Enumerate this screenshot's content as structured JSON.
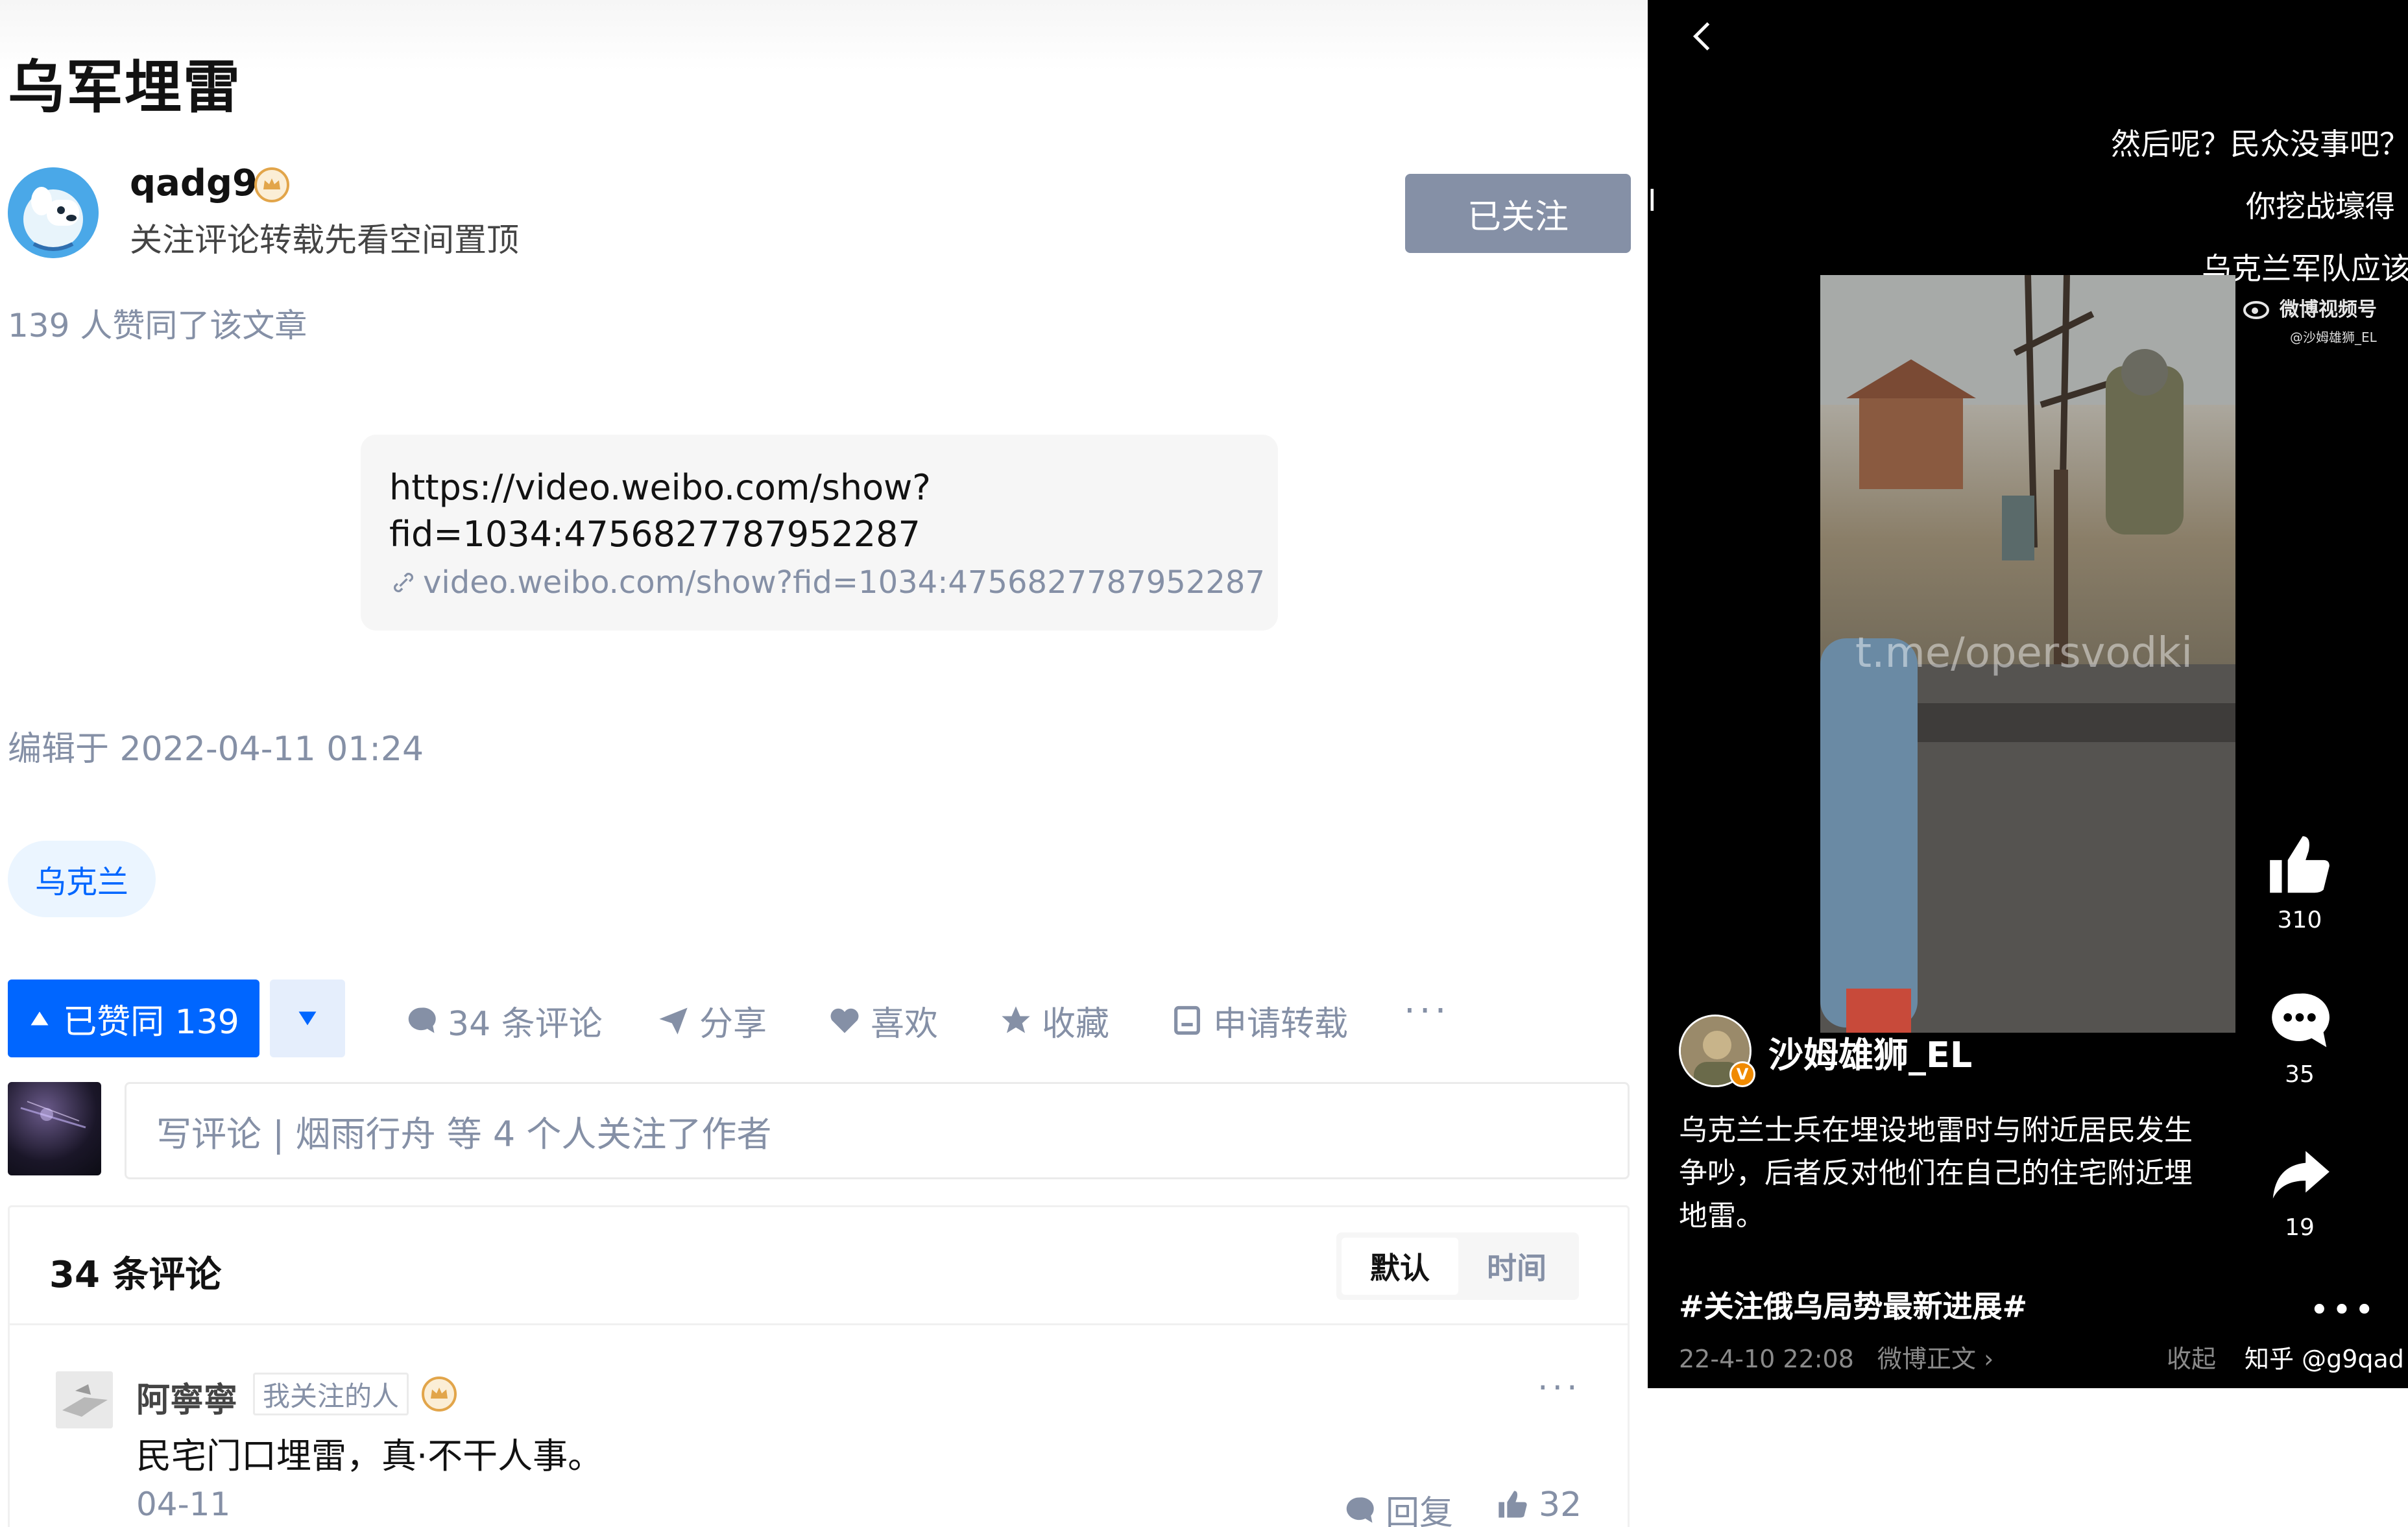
{
  "article": {
    "title": "乌军埋雷",
    "author": {
      "name": "qadg9",
      "bio": "关注评论转载先看空间置顶",
      "follow_label": "已关注"
    },
    "like_summary": "139 人赞同了该文章",
    "link_card": {
      "line1": "https://video.weibo.com/show?",
      "line2": "fid=1034:4756827787952287",
      "short_url": "video.weibo.com/show?fid=1034:4756827787952287"
    },
    "edited": "编辑于 2022-04-11 01:24",
    "topic": "乌克兰"
  },
  "actions": {
    "vote_up": "已赞同 139",
    "vote_down_icon": "triangle-down-icon",
    "comments": "34 条评论",
    "share": "分享",
    "like": "喜欢",
    "collect": "收藏",
    "repost": "申请转载",
    "more": "···"
  },
  "comment_input": {
    "placeholder": "写评论 | 烟雨行舟 等 4 个人关注了作者"
  },
  "comments": {
    "title": "34 条评论",
    "sort": [
      "默认",
      "时间"
    ],
    "items": [
      {
        "author": "阿寧寧",
        "tag": "我关注的人",
        "text": "民宅门口埋雷，真·不干人事。",
        "date": "04-11",
        "reply_label": "回复",
        "likes": "32"
      }
    ]
  },
  "weibo_video": {
    "danmaku": [
      "然后呢？民众没事吧？",
      "你挖战壕得",
      "乌克兰军队应该"
    ],
    "watermark": "微博视频号",
    "watermark_sub": "@沙姆雄狮_EL",
    "video_overlay": "t.me/opersvodki",
    "likes": "310",
    "comments": "35",
    "shares": "19",
    "user": "沙姆雄狮_EL",
    "verified": "V",
    "description": "乌克兰士兵在埋设地雷时与附近居民发生争吵，后者反对他们在自己的住宅附近埋地雷。",
    "hashtag": "#关注俄乌局势最新进展#",
    "time": "22-4-10 22:08",
    "source_link": "微博正文 ›",
    "collapse": "收起",
    "zhihu_mark": "知乎 @g9qad",
    "more": "•••",
    "stray_mark": "I"
  },
  "colors": {
    "zhihu_blue": "#0066ff",
    "follow_gray": "#8590a6",
    "weibo_bg": "#000000",
    "verified_orange": "#f08a00"
  }
}
